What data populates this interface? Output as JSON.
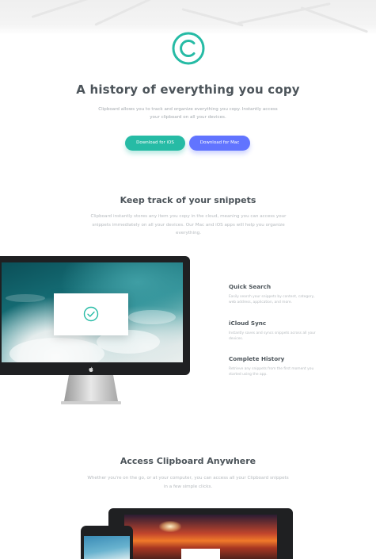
{
  "hero": {
    "title": "A history of everything you copy",
    "text": "Clipboard allows you to track and organize everything you copy. Instantly access your clipboard on all your devices.",
    "buttons": [
      {
        "label": "Download for iOS"
      },
      {
        "label": "Download for Mac"
      }
    ]
  },
  "snippets": {
    "title": "Keep track of your snippets",
    "text": "Clipboard instantly stores any item you copy in the cloud, meaning you can access your snippets immediately on all your devices. Our Mac and iOS apps will help you organize everything.",
    "features": [
      {
        "title": "Quick Search",
        "text": "Easily search your snippets by content, category, web address, application, and more."
      },
      {
        "title": "iCloud Sync",
        "text": "Instantly saves and syncs snippets across all your devices."
      },
      {
        "title": "Complete History",
        "text": "Retrieve any snippets from the first moment you started using the app."
      }
    ]
  },
  "access": {
    "title": "Access Clipboard Anywhere",
    "text": "Whether you're on the go, or at your computer, you can access all your Clipboard snippets in a few simple clicks."
  },
  "colors": {
    "accent_teal": "#26bba5",
    "accent_blue": "#6174ff",
    "heading": "#4c545a",
    "body_text": "#a3a9ae"
  },
  "icons": {
    "logo": "copyright-logo-icon",
    "check": "check-circle-icon",
    "apple": "apple-logo-icon"
  }
}
